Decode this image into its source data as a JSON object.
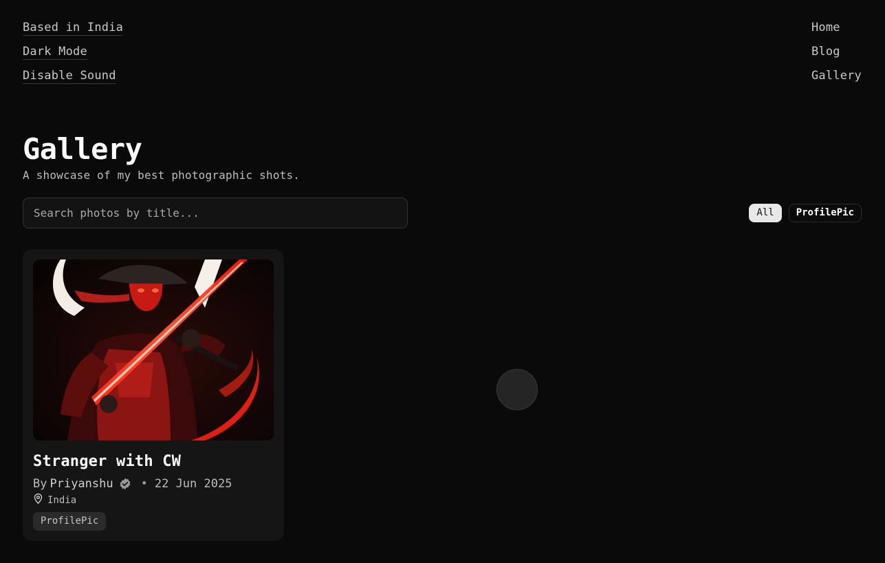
{
  "nav_left": {
    "location": "Based in India",
    "theme": "Dark Mode",
    "sound": "Disable Sound"
  },
  "nav_right": {
    "home": "Home",
    "blog": "Blog",
    "gallery": "Gallery"
  },
  "page": {
    "title": "Gallery",
    "subtitle": "A showcase of my best photographic shots."
  },
  "search": {
    "placeholder": "Search photos by title...",
    "value": ""
  },
  "filters": [
    {
      "label": "All",
      "active": true
    },
    {
      "label": "ProfilePic",
      "active": false
    }
  ],
  "photos": [
    {
      "title": "Stranger with CW",
      "by_label": "By",
      "author": "Priyanshu",
      "date": "22 Jun 2025",
      "location": "India",
      "tag": "ProfilePic",
      "image_icon": "red-samurai-artwork"
    }
  ],
  "colors": {
    "background": "#0a0a0a",
    "card": "#151515",
    "accent_red": "#e0201a"
  }
}
